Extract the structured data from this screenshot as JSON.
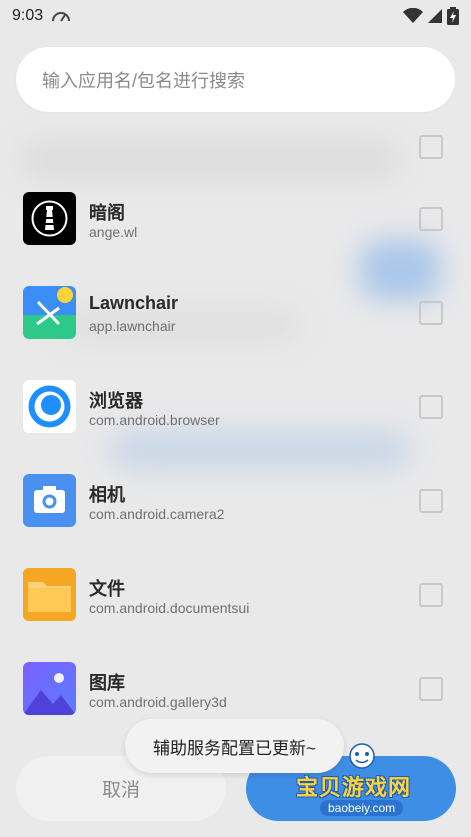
{
  "status_bar": {
    "time": "9:03",
    "icons": [
      "speedometer-icon",
      "wifi-icon",
      "signal-icon",
      "battery-charging-icon"
    ]
  },
  "search": {
    "placeholder": "输入应用名/包名进行搜索"
  },
  "apps": [
    {
      "name": "暗阁",
      "package": "ange.wl",
      "icon": "lighthouse-app-icon",
      "checked": false
    },
    {
      "name": "Lawnchair",
      "package": "app.lawnchair",
      "icon": "lawnchair-app-icon",
      "checked": false
    },
    {
      "name": "浏览器",
      "package": "com.android.browser",
      "icon": "browser-app-icon",
      "checked": false
    },
    {
      "name": "相机",
      "package": "com.android.camera2",
      "icon": "camera-app-icon",
      "checked": false
    },
    {
      "name": "文件",
      "package": "com.android.documentsui",
      "icon": "folder-app-icon",
      "checked": false
    },
    {
      "name": "图库",
      "package": "com.android.gallery3d",
      "icon": "gallery-app-icon",
      "checked": false
    }
  ],
  "toast": {
    "text": "辅助服务配置已更新~"
  },
  "buttons": {
    "cancel": "取消"
  },
  "watermark": {
    "title": "宝贝游戏网",
    "url": "baobeiy.com"
  },
  "colors": {
    "accent": "#3f8ee6",
    "background": "#e9e9ea",
    "card": "#ffffff"
  }
}
